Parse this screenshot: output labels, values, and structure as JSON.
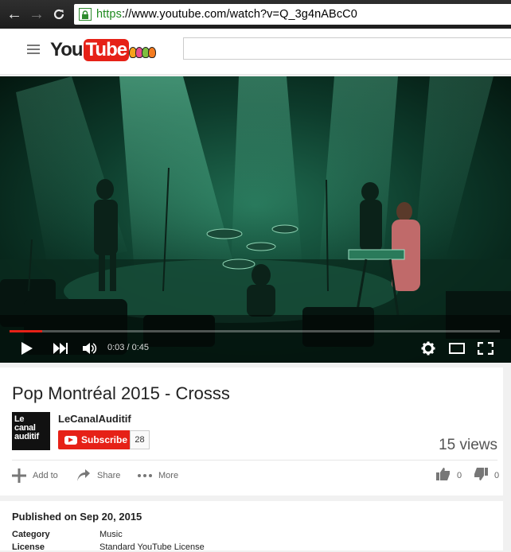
{
  "browser": {
    "url_scheme": "https",
    "url_rest": "://www.youtube.com/watch?v=Q_3g4nABcC0"
  },
  "header": {
    "logo_you": "You",
    "logo_tube": "Tube"
  },
  "player": {
    "time": "0:03 / 0:45",
    "progress": 0.067
  },
  "video": {
    "title": "Pop Montréal 2015 - Crosss",
    "channel": "LeCanalAuditif",
    "avatar_text": [
      "Le",
      "canal",
      "auditif"
    ],
    "subscribe_label": "Subscribe",
    "subscriber_count": "28",
    "views": "15 views"
  },
  "actions": {
    "add_to": "Add to",
    "share": "Share",
    "more": "More",
    "likes": "0",
    "dislikes": "0"
  },
  "details": {
    "published": "Published on Sep 20, 2015",
    "category_label": "Category",
    "category_value": "Music",
    "license_label": "License",
    "license_value": "Standard YouTube License"
  },
  "colors": {
    "brand_red": "#e62117",
    "secure_green": "#1e8a1e"
  }
}
